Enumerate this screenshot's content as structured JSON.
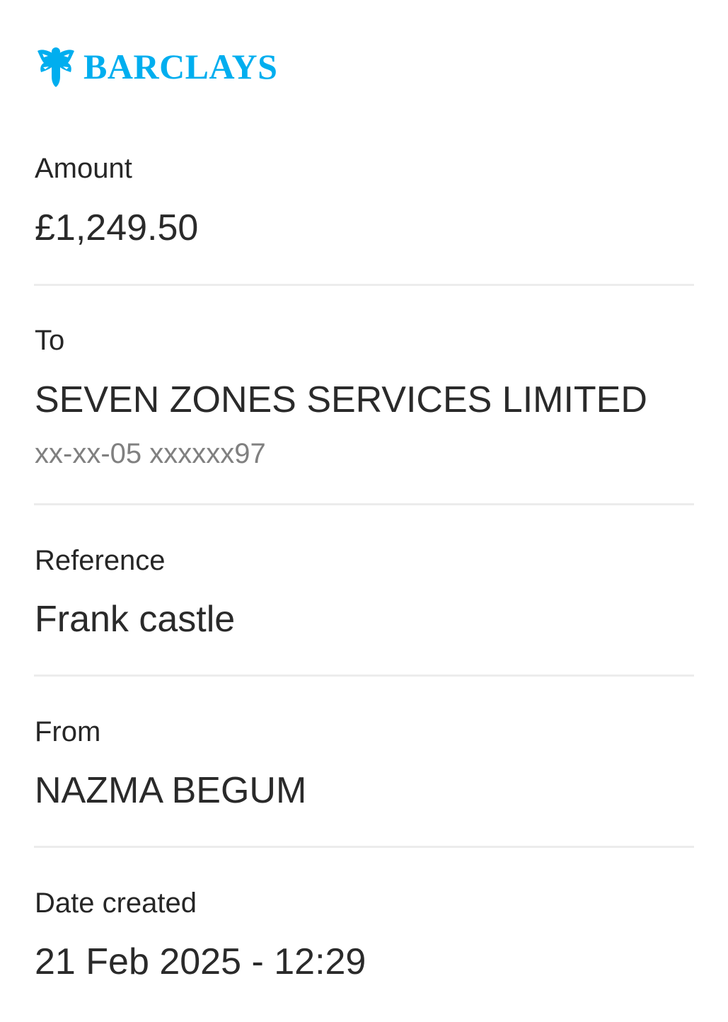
{
  "brand": {
    "name": "BARCLAYS",
    "color": "#00AEEF",
    "icon": "eagle-icon"
  },
  "payment": {
    "amount": {
      "label": "Amount",
      "value": "£1,249.50"
    },
    "to": {
      "label": "To",
      "name": "SEVEN ZONES SERVICES LIMITED",
      "account": "xx-xx-05 xxxxxx97"
    },
    "reference": {
      "label": "Reference",
      "value": "Frank castle"
    },
    "from": {
      "label": "From",
      "value": "NAZMA BEGUM"
    },
    "date_created": {
      "label": "Date created",
      "value": "21 Feb 2025 - 12:29"
    }
  }
}
